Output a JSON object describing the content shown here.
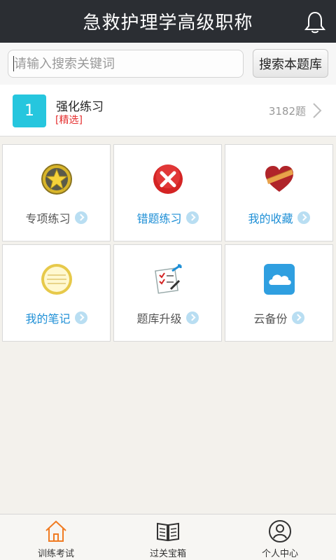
{
  "header": {
    "title": "急救护理学高级职称",
    "bell_icon": "bell-icon"
  },
  "search": {
    "placeholder": "请输入搜索关键词",
    "button_label": "搜索本题库"
  },
  "practice": {
    "badge": "1",
    "title": "强化练习",
    "tag": "[精选]",
    "count": "3182题"
  },
  "tiles": [
    {
      "label": "专项练习",
      "icon": "star-badge-icon",
      "color": "#555555"
    },
    {
      "label": "错题练习",
      "icon": "red-x-icon",
      "color": "#1e8fd6"
    },
    {
      "label": "我的收藏",
      "icon": "heart-icon",
      "color": "#1e8fd6"
    },
    {
      "label": "我的笔记",
      "icon": "notepad-icon",
      "color": "#1e8fd6"
    },
    {
      "label": "题库升级",
      "icon": "checklist-icon",
      "color": "#555555"
    },
    {
      "label": "云备份",
      "icon": "cloud-icon",
      "color": "#555555"
    }
  ],
  "tabs": [
    {
      "label": "训练考试",
      "icon": "home-icon",
      "active": true
    },
    {
      "label": "过关宝箱",
      "icon": "book-icon",
      "active": false
    },
    {
      "label": "个人中心",
      "icon": "user-icon",
      "active": false
    }
  ],
  "colors": {
    "header_bg": "#2b2e33",
    "accent_blue": "#1e8fd6",
    "badge_teal": "#26c6de",
    "tag_red": "#e53030",
    "tab_active": "#f07b22"
  }
}
